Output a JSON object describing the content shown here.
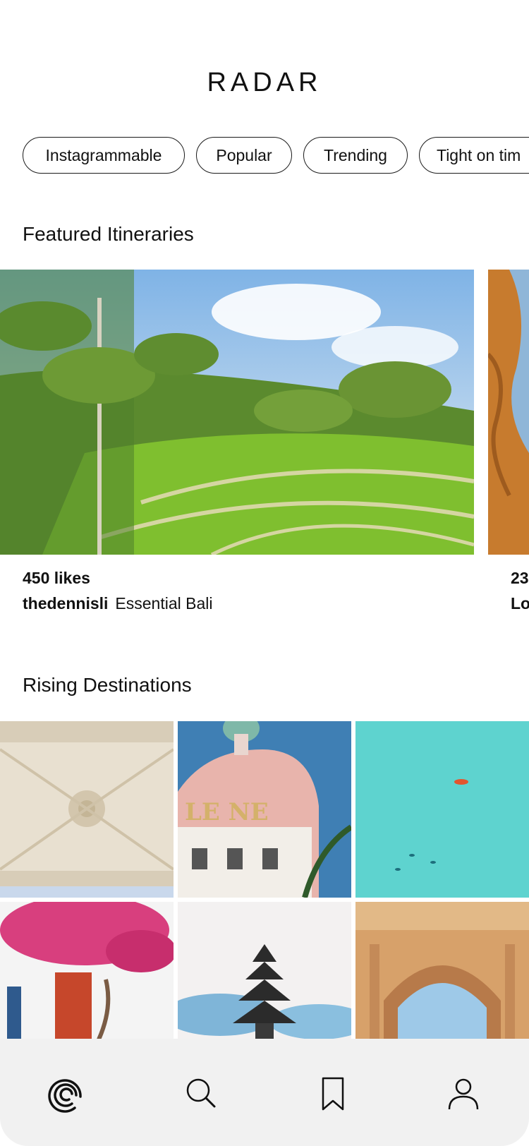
{
  "app": {
    "logo_text": "RADAR"
  },
  "filters": [
    {
      "label": "Instagrammable"
    },
    {
      "label": "Popular"
    },
    {
      "label": "Trending"
    },
    {
      "label": "Tight on tim"
    }
  ],
  "featured": {
    "title": "Featured Itineraries",
    "cards": [
      {
        "likes": "450 likes",
        "user": "thedennisli",
        "itinerary": "Essential Bali"
      },
      {
        "likes": "23",
        "user": "Lo"
      }
    ]
  },
  "rising": {
    "title": "Rising Destinations"
  },
  "tabbar": {
    "items": [
      {
        "icon": "radar-icon"
      },
      {
        "icon": "search-icon"
      },
      {
        "icon": "bookmark-icon"
      },
      {
        "icon": "profile-icon"
      }
    ]
  },
  "colors": {
    "background": "#ffffff",
    "tabbar": "#f1f1f1",
    "text": "#111111"
  }
}
